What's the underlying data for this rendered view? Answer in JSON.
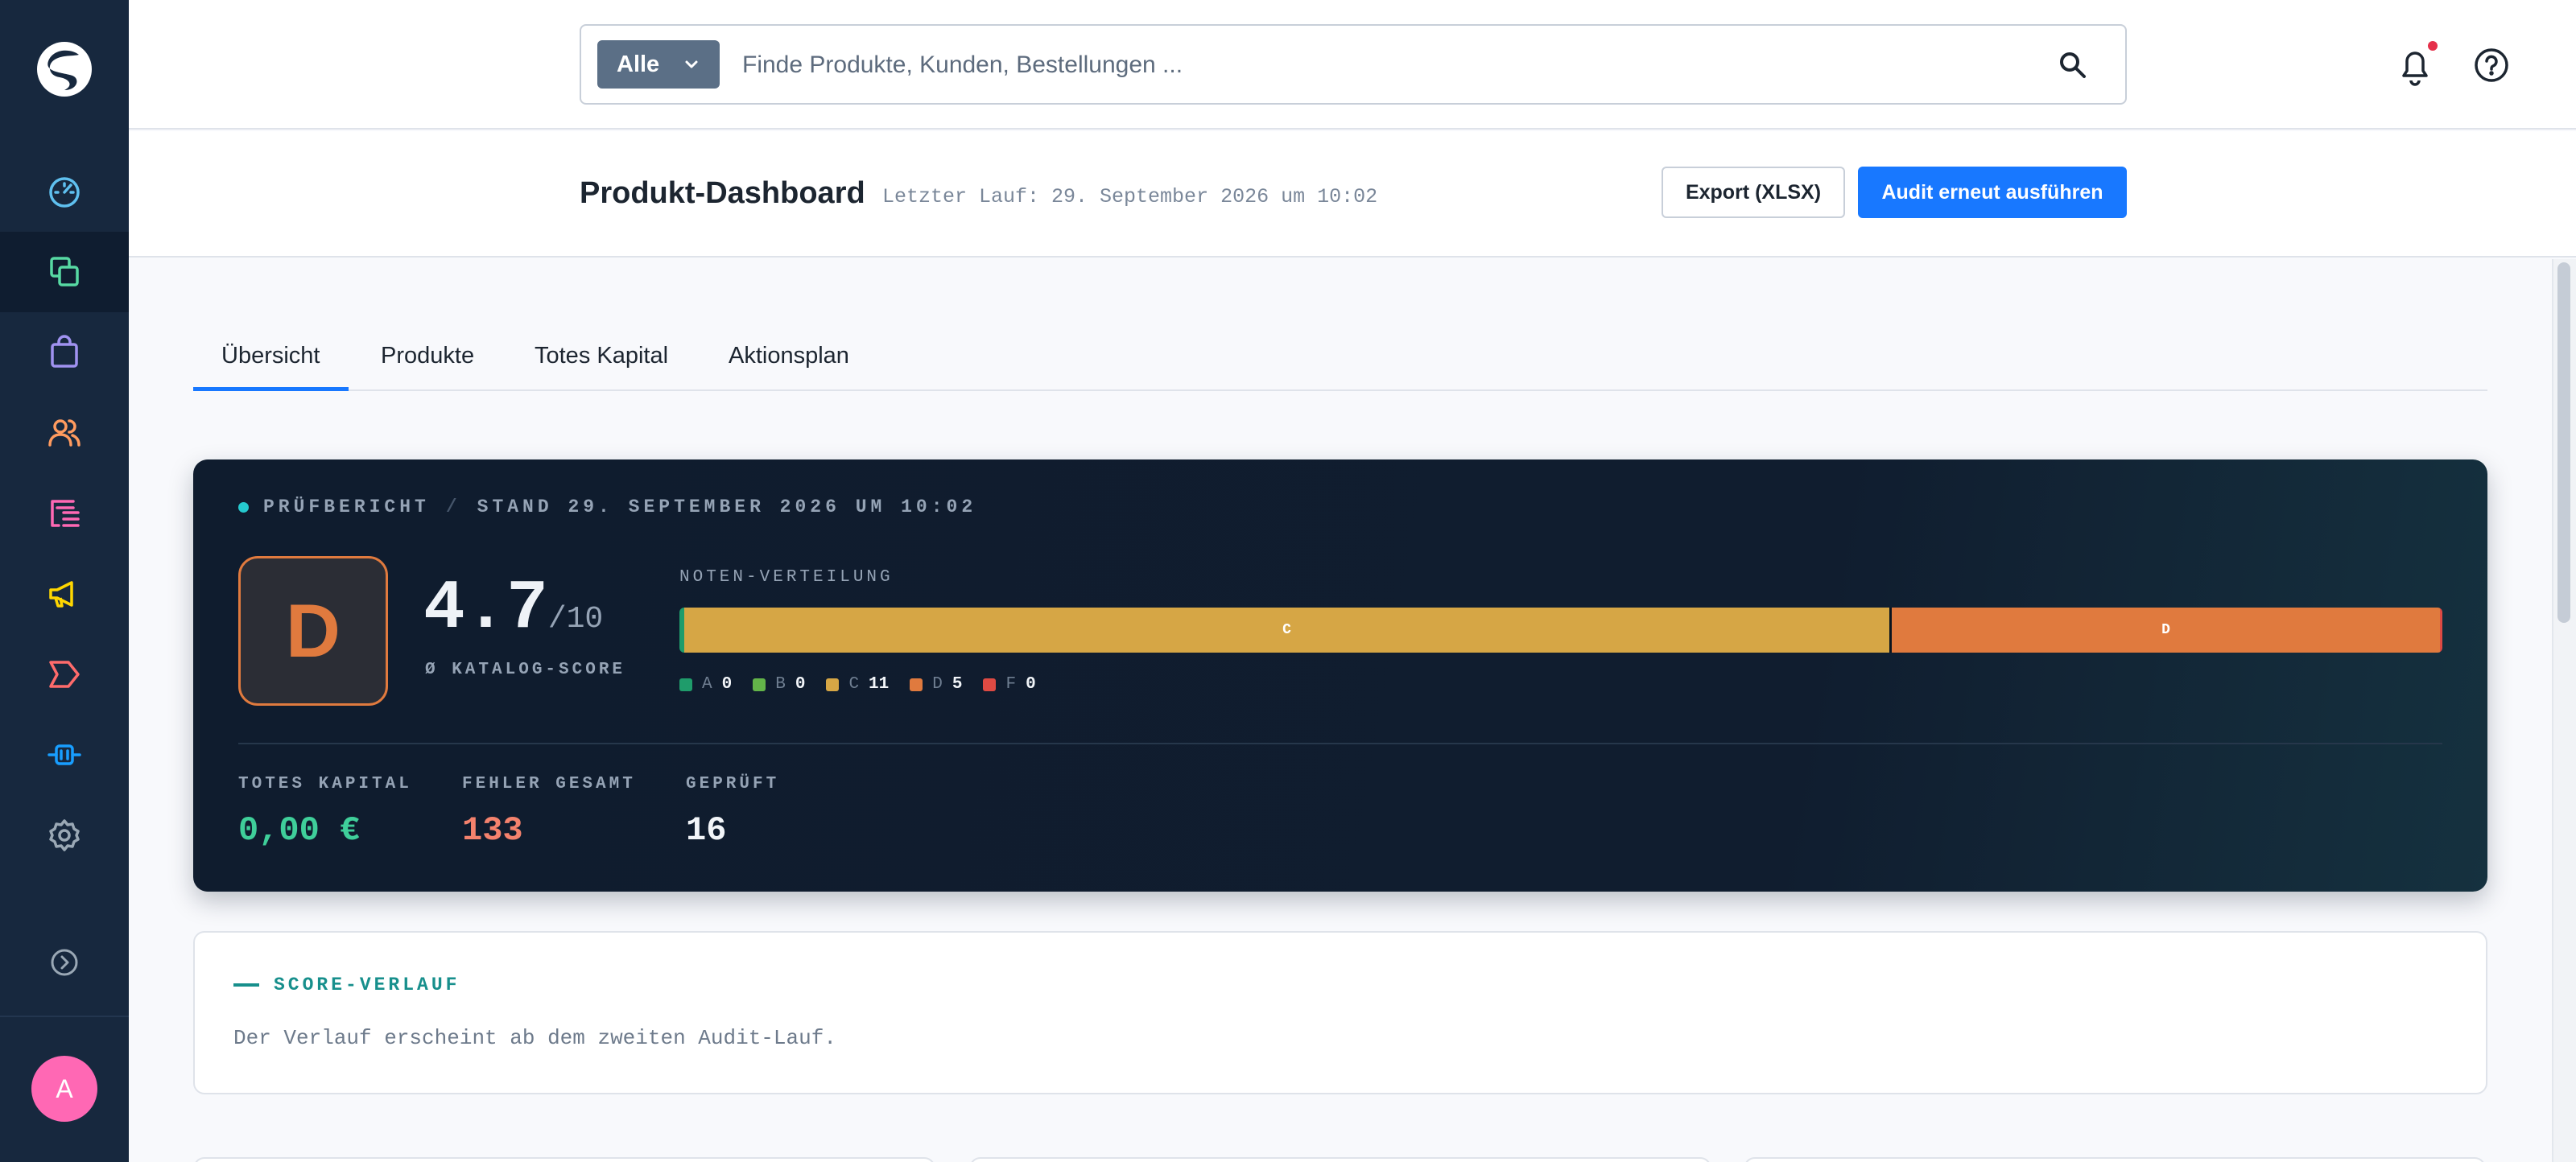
{
  "colors": {
    "sidebar_bg": "#17283e",
    "accent": "#1878ff",
    "grade_d": "#e07a3e",
    "teal": "#178f8c",
    "dead_capital": "#3fcf9a",
    "errors": "#f4826d"
  },
  "sidebar": {
    "logo": "shopware-logo",
    "items": [
      {
        "name": "dashboard",
        "icon": "speedometer-icon",
        "color": "#5fc0ef"
      },
      {
        "name": "catalogues",
        "icon": "copy-icon",
        "color": "#57d9a3",
        "active": true
      },
      {
        "name": "orders",
        "icon": "shopping-bag-icon",
        "color": "#a092f0"
      },
      {
        "name": "customers",
        "icon": "users-icon",
        "color": "#ff9b5f"
      },
      {
        "name": "content",
        "icon": "content-list-icon",
        "color": "#ff68b4"
      },
      {
        "name": "marketing",
        "icon": "megaphone-icon",
        "color": "#ffd700"
      },
      {
        "name": "sales-channels",
        "icon": "chevron-badge-icon",
        "color": "#ff6b6b"
      },
      {
        "name": "extensions",
        "icon": "plug-icon",
        "color": "#189eff"
      },
      {
        "name": "settings",
        "icon": "gear-icon",
        "color": "#9aa8b5"
      }
    ],
    "expand_icon": "chevron-circle-right-icon",
    "avatar_letter": "A"
  },
  "topbar": {
    "search_type": "Alle",
    "search_placeholder": "Finde Produkte, Kunden, Bestellungen ...",
    "search_value": "",
    "notification_icon": "bell-icon",
    "help_icon": "question-circle-icon"
  },
  "header": {
    "title": "Produkt-Dashboard",
    "last_run": "Letzter Lauf: 29. September 2026 um 10:02",
    "export_label": "Export (XLSX)",
    "rerun_label": "Audit erneut ausführen"
  },
  "tabs": [
    {
      "label": "Übersicht",
      "active": true
    },
    {
      "label": "Produkte",
      "active": false
    },
    {
      "label": "Totes Kapital",
      "active": false
    },
    {
      "label": "Aktionsplan",
      "active": false
    }
  ],
  "audit": {
    "report_label": "PRÜFBERICHT",
    "separator": "/",
    "stand": "STAND 29. SEPTEMBER 2026 UM 10:02",
    "grade": "D",
    "score": "4.7",
    "score_max": "/10",
    "score_label": "Ø KATALOG-SCORE",
    "distribution_label": "NOTEN-VERTEILUNG",
    "distribution": [
      {
        "grade": "A",
        "count": 0,
        "color": "#1f9c6b"
      },
      {
        "grade": "B",
        "count": 0,
        "color": "#63b449"
      },
      {
        "grade": "C",
        "count": 11,
        "color": "#d6a645"
      },
      {
        "grade": "D",
        "count": 5,
        "color": "#e07a3e"
      },
      {
        "grade": "F",
        "count": 0,
        "color": "#de4a43"
      }
    ],
    "stats": [
      {
        "label": "TOTES KAPITAL",
        "value": "0,00 €",
        "color": "#3fcf9a"
      },
      {
        "label": "FEHLER GESAMT",
        "value": "133",
        "color": "#f4826d"
      },
      {
        "label": "GEPRÜFT",
        "value": "16",
        "color": "#f2f5f9"
      }
    ]
  },
  "history": {
    "title": "SCORE-VERLAUF",
    "empty_text": "Der Verlauf erscheint ab dem zweiten Audit-Lauf."
  }
}
